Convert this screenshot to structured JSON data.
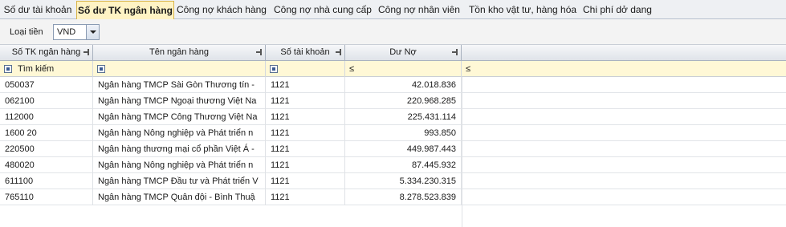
{
  "tabs": [
    {
      "label": "Số dư tài khoản"
    },
    {
      "label": "Số dư TK ngân hàng"
    },
    {
      "label": "Công nợ khách hàng"
    },
    {
      "label": "Công nợ nhà cung cấp"
    },
    {
      "label": "Công nợ nhân viên"
    },
    {
      "label": "Tồn kho vật tư, hàng hóa"
    },
    {
      "label": "Chi phí dở dang"
    }
  ],
  "toolbar": {
    "currency_label": "Loại tiền",
    "currency_value": "VND"
  },
  "grid": {
    "columns": [
      "Số TK ngân hàng",
      "Tên ngân hàng",
      "Số tài khoản",
      "Dư Nợ"
    ],
    "filter": {
      "search_placeholder": "Tìm kiếm",
      "op_balance": "≤",
      "op_extra": "≤"
    },
    "rows": [
      {
        "account_no": "050037",
        "bank_name": "Ngân hàng TMCP Sài Gòn Thương tín -",
        "gl_account": "1121",
        "debit": "42.018.836"
      },
      {
        "account_no": "062100",
        "bank_name": "Ngân hàng TMCP Ngoại thương Việt Na",
        "gl_account": "1121",
        "debit": "220.968.285"
      },
      {
        "account_no": "112000",
        "bank_name": "Ngân hàng TMCP Công Thương Việt Na",
        "gl_account": "1121",
        "debit": "225.431.114"
      },
      {
        "account_no": "1600 20",
        "bank_name": "Ngân hàng Nông nghiệp và Phát triển n",
        "gl_account": "1121",
        "debit": "993.850"
      },
      {
        "account_no": "220500",
        "bank_name": "Ngân hàng thương mại cổ phần Việt Á -",
        "gl_account": "1121",
        "debit": "449.987.443"
      },
      {
        "account_no": "480020",
        "bank_name": "Ngân hàng Nông nghiệp và Phát triển n",
        "gl_account": "1121",
        "debit": "87.445.932"
      },
      {
        "account_no": "611100",
        "bank_name": "Ngân hàng TMCP Đầu tư và Phát triển V",
        "gl_account": "1121",
        "debit": "5.334.230.315"
      },
      {
        "account_no": "765110",
        "bank_name": "Ngân hàng TMCP Quân đội  - Bình Thuậ",
        "gl_account": "1121",
        "debit": "8.278.523.839"
      }
    ]
  }
}
